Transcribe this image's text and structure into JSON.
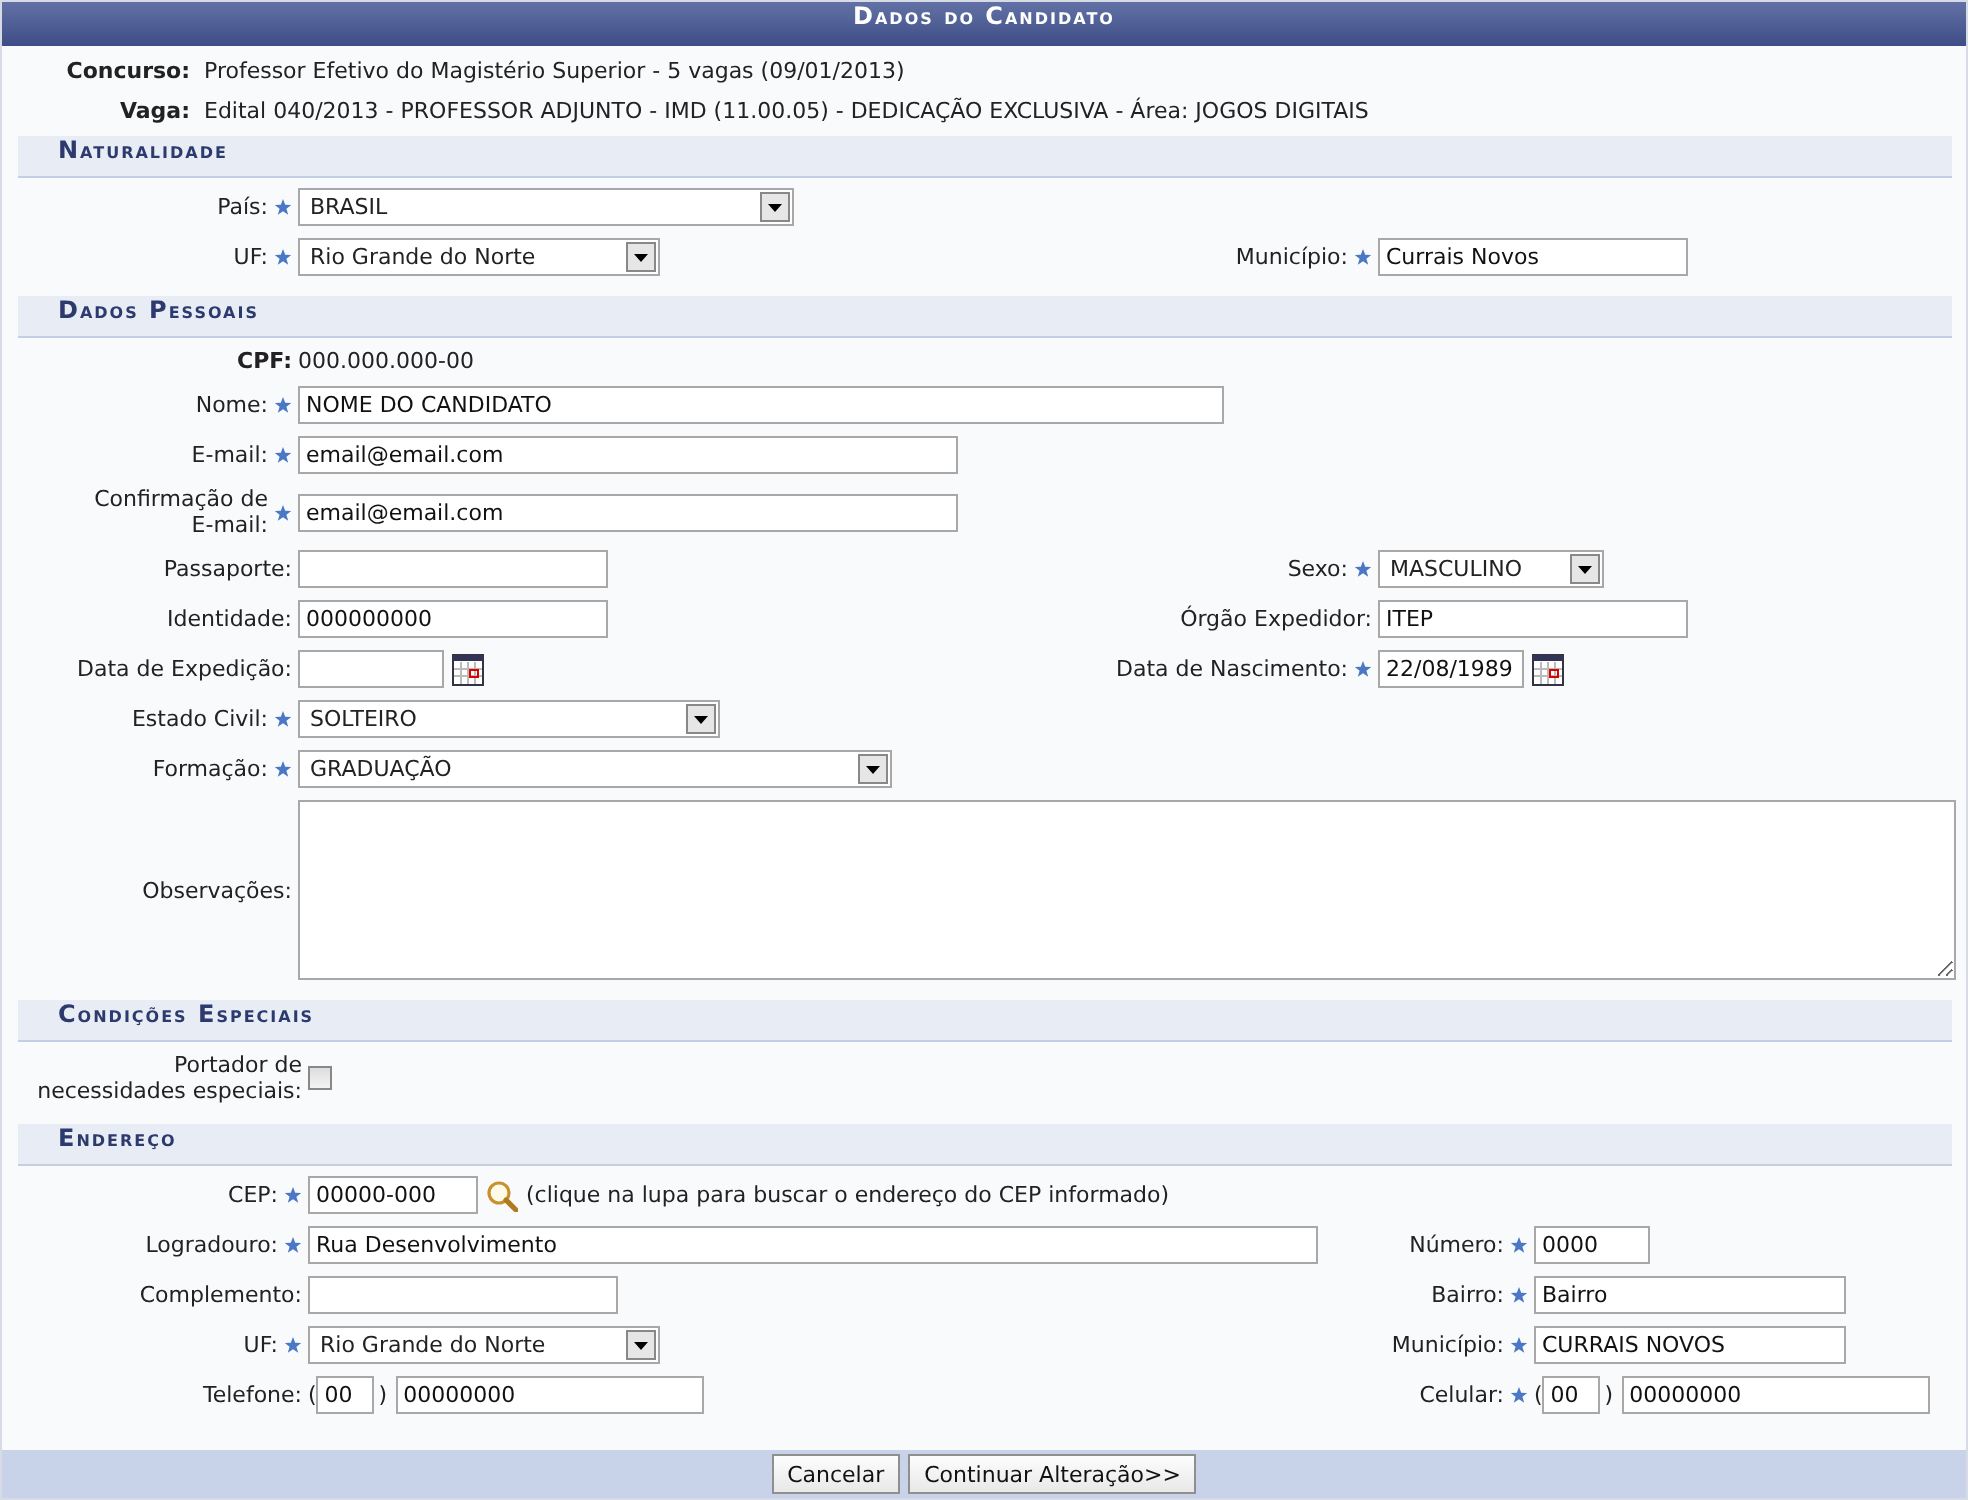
{
  "title": "Dados do Candidato",
  "info": [
    {
      "label": "Concurso:",
      "value": "Professor Efetivo do Magistério Superior - 5 vagas (09/01/2013)"
    },
    {
      "label": "Vaga:",
      "value": "Edital 040/2013 - PROFESSOR ADJUNTO - IMD (11.00.05) - DEDICAÇÃO EXCLUSIVA - Área: JOGOS DIGITAIS"
    }
  ],
  "sections": [
    {
      "heading": "Naturalidade",
      "rows": [
        {
          "cells": [
            {
              "kind": "select",
              "label": "País:",
              "required": true,
              "value": "BRASIL"
            }
          ]
        },
        {
          "cells": [
            {
              "kind": "select",
              "label": "UF:",
              "required": true,
              "value": "Rio Grande do Norte"
            },
            {
              "kind": "text",
              "label": "Município:",
              "required": true,
              "value": "Currais Novos"
            }
          ]
        }
      ]
    },
    {
      "heading": "Dados Pessoais",
      "rows": [
        {
          "cells": [
            {
              "kind": "static",
              "label": "CPF:",
              "value": "000.000.000-00"
            }
          ]
        },
        {
          "cells": [
            {
              "kind": "text",
              "label": "Nome:",
              "required": true,
              "value": "NOME DO CANDIDATO"
            }
          ]
        },
        {
          "cells": [
            {
              "kind": "text",
              "label": "E-mail:",
              "required": true,
              "value": "email@email.com"
            }
          ]
        },
        {
          "cells": [
            {
              "kind": "text",
              "label": "Confirmação de E-mail:",
              "required": true,
              "value": "email@email.com"
            }
          ]
        },
        {
          "cells": [
            {
              "kind": "text",
              "label": "Passaporte:",
              "required": false
            },
            {
              "kind": "select",
              "label": "Sexo:",
              "required": true,
              "value": "MASCULINO"
            }
          ]
        },
        {
          "cells": [
            {
              "kind": "text",
              "label": "Identidade:",
              "required": false,
              "value": "000000000"
            },
            {
              "kind": "text",
              "label": "Órgão Expedidor:",
              "required": false,
              "value": "ITEP"
            }
          ]
        },
        {
          "cells": [
            {
              "kind": "date",
              "label": "Data de Expedição:",
              "required": false
            },
            {
              "kind": "date",
              "label": "Data de Nascimento:",
              "required": true,
              "value": "22/08/1989"
            }
          ]
        },
        {
          "cells": [
            {
              "kind": "select",
              "label": "Estado Civil:",
              "required": true,
              "value": "SOLTEIRO"
            }
          ]
        },
        {
          "cells": [
            {
              "kind": "select",
              "label": "Formação:",
              "required": true,
              "value": "GRADUAÇÃO"
            }
          ]
        },
        {
          "cells": [
            {
              "kind": "textarea",
              "label": "Observações:",
              "required": false
            }
          ]
        }
      ]
    },
    {
      "heading": "Condições Especiais",
      "rows": [
        {
          "cells": [
            {
              "kind": "checkbox",
              "label": "Portador de necessidades especiais:",
              "checked": false
            }
          ]
        }
      ]
    },
    {
      "heading": "Endereço",
      "rows": [
        {
          "cells": [
            {
              "kind": "cep",
              "label": "CEP:",
              "required": true,
              "value": "00000-000",
              "hint": "(clique na lupa para buscar o endereço do CEP informado)"
            }
          ]
        },
        {
          "cells": [
            {
              "kind": "text",
              "label": "Logradouro:",
              "required": true,
              "value": "Rua Desenvolvimento"
            },
            {
              "kind": "text",
              "label": "Número:",
              "required": true,
              "value": "0000"
            }
          ]
        },
        {
          "cells": [
            {
              "kind": "text",
              "label": "Complemento:",
              "required": false
            },
            {
              "kind": "text",
              "label": "Bairro:",
              "required": true,
              "value": "Bairro"
            }
          ]
        },
        {
          "cells": [
            {
              "kind": "select",
              "label": "UF:",
              "required": true,
              "value": "Rio Grande do Norte"
            },
            {
              "kind": "text",
              "label": "Município:",
              "required": true,
              "value": "CURRAIS NOVOS"
            }
          ]
        },
        {
          "cells": [
            {
              "kind": "phone",
              "label": "Telefone:",
              "required": false,
              "open": "(",
              "area_code": "00",
              "close": ")",
              "number": "00000000"
            },
            {
              "kind": "phone",
              "label": "Celular:",
              "required": true,
              "open": "(",
              "area_code": "00",
              "close": ")",
              "number": "00000000"
            }
          ]
        }
      ]
    }
  ],
  "buttons": [
    "Cancelar",
    "Continuar Alteração>>"
  ]
}
